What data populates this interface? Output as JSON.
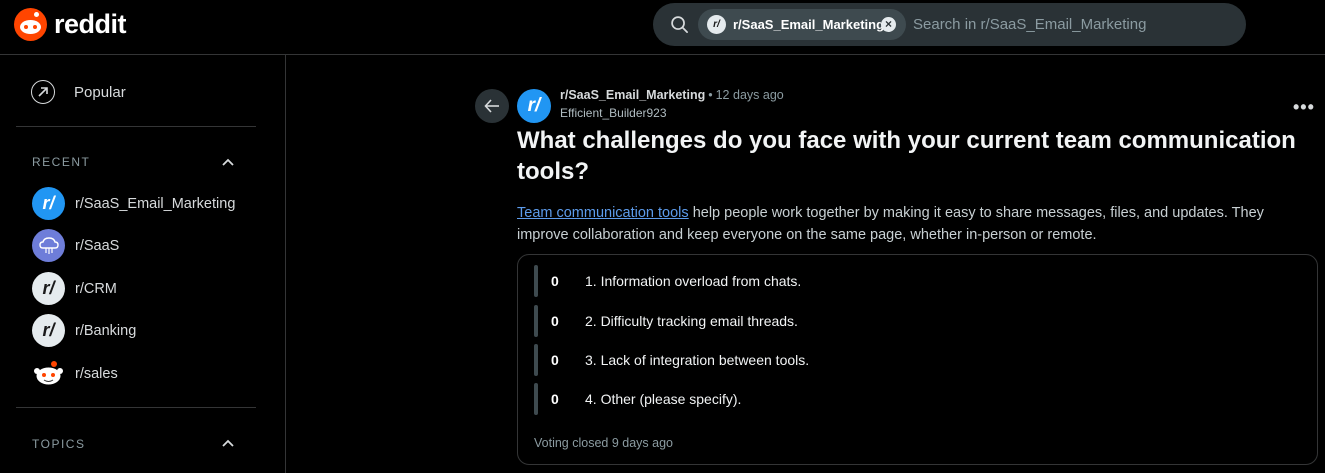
{
  "header": {
    "logo_text": "reddit",
    "search": {
      "chip_icon": "r/",
      "chip_label": "r/SaaS_Email_Marketing",
      "chip_clear": "×",
      "placeholder": "Search in r/SaaS_Email_Marketing"
    }
  },
  "sidebar": {
    "popular_label": "Popular",
    "recent_heading": "RECENT",
    "topics_heading": "TOPICS",
    "recent": [
      {
        "label": "r/SaaS_Email_Marketing",
        "icon": "r/"
      },
      {
        "label": "r/SaaS",
        "icon": "cloud-icon"
      },
      {
        "label": "r/CRM",
        "icon": "r/"
      },
      {
        "label": "r/Banking",
        "icon": "r/"
      },
      {
        "label": "r/sales",
        "icon": "snoo-icon"
      }
    ]
  },
  "post": {
    "subreddit_icon": "r/",
    "subreddit": "r/SaaS_Email_Marketing",
    "separator": "•",
    "time": "12 days ago",
    "author": "Efficient_Builder923",
    "more": "•••",
    "title": "What challenges do you face with your current team communication tools?",
    "body_link": "Team communication tools",
    "body_text": " help people work together by making it easy to share messages, files, and updates. They improve collaboration and keep everyone on the same page, whether in-person or remote.",
    "poll": {
      "options": [
        {
          "count": "0",
          "text": "1. Information overload from chats."
        },
        {
          "count": "0",
          "text": "2. Difficulty tracking email threads."
        },
        {
          "count": "0",
          "text": "3. Lack of integration between tools."
        },
        {
          "count": "0",
          "text": "4. Other (please specify)."
        }
      ],
      "status": "Voting closed 9 days ago"
    }
  }
}
